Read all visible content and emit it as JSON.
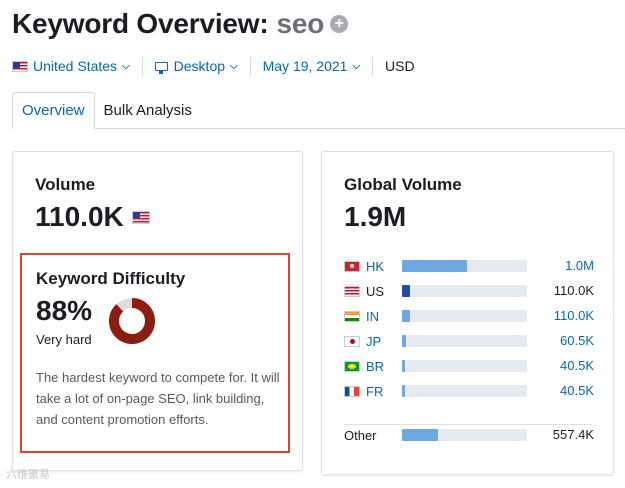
{
  "header": {
    "title": "Keyword Overview:",
    "keyword": "seo",
    "add_icon": "plus-circle-icon"
  },
  "filters": {
    "country": "United States",
    "device": "Desktop",
    "date": "May 19, 2021",
    "currency": "USD"
  },
  "tabs": [
    {
      "label": "Overview",
      "active": true
    },
    {
      "label": "Bulk Analysis",
      "active": false
    }
  ],
  "volume": {
    "label": "Volume",
    "value": "110.0K",
    "flag": "us-flag-icon"
  },
  "keyword_difficulty": {
    "label": "Keyword Difficulty",
    "percent": "88%",
    "percent_value": 88,
    "level": "Very hard",
    "description": "The hardest keyword to compete for. It will take a lot of on-page SEO, link building, and content promotion efforts.",
    "donut_color": "#8b1d12",
    "donut_track_color": "#dcdcdc"
  },
  "global_volume": {
    "label": "Global Volume",
    "value": "1.9M",
    "rows": [
      {
        "code": "HK",
        "value": "1.0M",
        "share": 0.52,
        "link": true
      },
      {
        "code": "US",
        "value": "110.0K",
        "share": 0.06,
        "link": false
      },
      {
        "code": "IN",
        "value": "110.0K",
        "share": 0.06,
        "link": true
      },
      {
        "code": "JP",
        "value": "60.5K",
        "share": 0.03,
        "link": true
      },
      {
        "code": "BR",
        "value": "40.5K",
        "share": 0.02,
        "link": true
      },
      {
        "code": "FR",
        "value": "40.5K",
        "share": 0.02,
        "link": true
      }
    ],
    "other": {
      "label": "Other",
      "value": "557.4K",
      "share": 0.29
    }
  },
  "watermark": "六维聚易"
}
